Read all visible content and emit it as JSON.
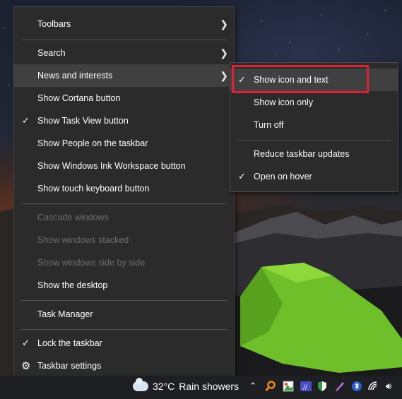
{
  "main_menu": {
    "toolbars": "Toolbars",
    "search": "Search",
    "news": "News and interests",
    "cortana": "Show Cortana button",
    "task_view": "Show Task View button",
    "people": "Show People on the taskbar",
    "ink": "Show Windows Ink Workspace button",
    "touch_keyboard": "Show touch keyboard button",
    "cascade": "Cascade windows",
    "stacked": "Show windows stacked",
    "side_by_side": "Show windows side by side",
    "desktop": "Show the desktop",
    "task_manager": "Task Manager",
    "lock": "Lock the taskbar",
    "settings": "Taskbar settings"
  },
  "sub_menu": {
    "icon_text": "Show icon and text",
    "icon_only": "Show icon only",
    "turn_off": "Turn off",
    "reduce_updates": "Reduce taskbar updates",
    "open_hover": "Open on hover"
  },
  "taskbar": {
    "temperature": "32°C",
    "condition": "Rain showers"
  },
  "colors": {
    "menu_bg": "#2b2b2b",
    "hover_bg": "#404040",
    "disabled_text": "#6d6d6d",
    "annotation_box": "#e02035"
  }
}
